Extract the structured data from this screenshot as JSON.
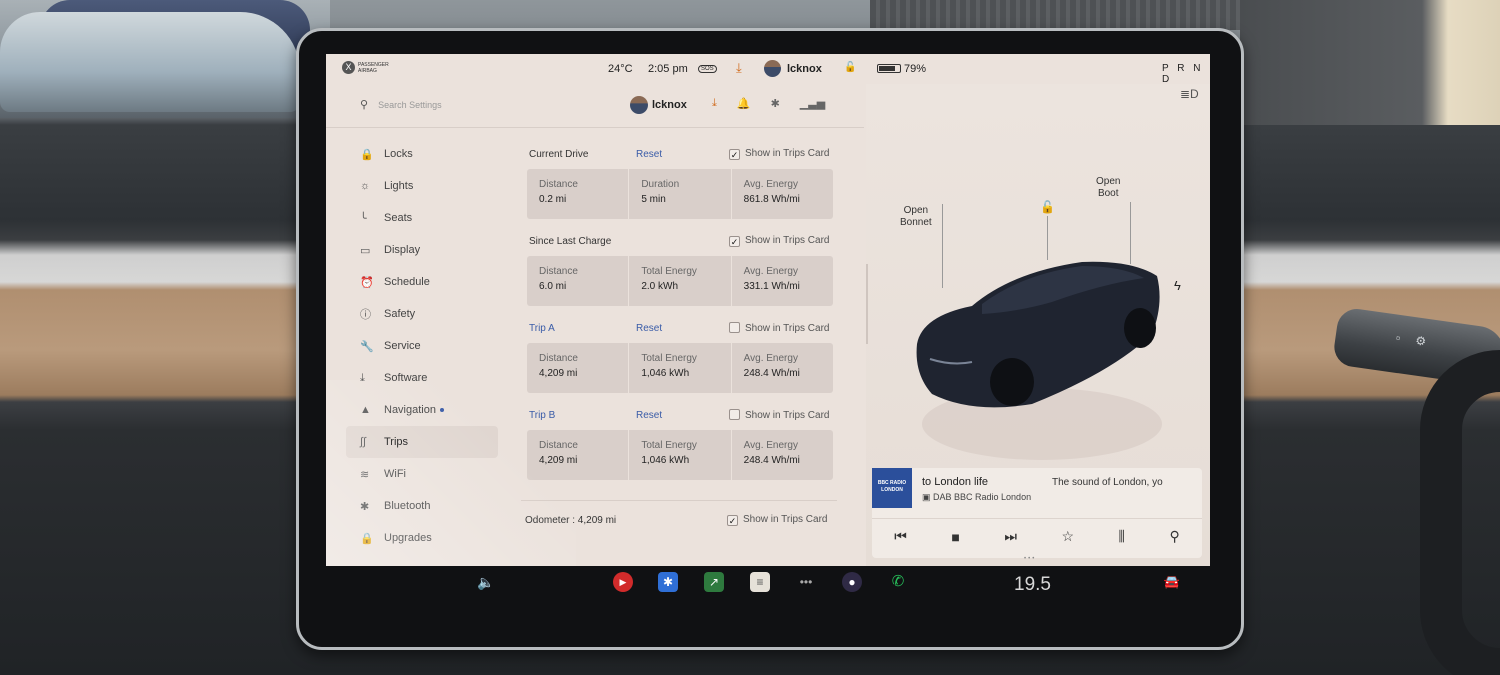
{
  "status_bar": {
    "airbag_line1": "PASSENGER",
    "airbag_line2": "AIRBAG",
    "airbag_icon": "X",
    "temperature": "24°C",
    "time": "2:05 pm",
    "sos": "SOS",
    "user": "lcknox",
    "battery_percent": "79%",
    "battery_level": 0.79,
    "gear": "P R N D"
  },
  "settings_header": {
    "search_placeholder": "Search Settings",
    "user": "lcknox"
  },
  "sidebar": {
    "items": [
      {
        "label": "Locks",
        "icon": "🔒"
      },
      {
        "label": "Lights",
        "icon": "☼"
      },
      {
        "label": "Seats",
        "icon": "╰"
      },
      {
        "label": "Display",
        "icon": "▭"
      },
      {
        "label": "Schedule",
        "icon": "⏰"
      },
      {
        "label": "Safety",
        "icon": "ⓘ"
      },
      {
        "label": "Service",
        "icon": "🔧"
      },
      {
        "label": "Software",
        "icon": "⤓"
      },
      {
        "label": "Navigation",
        "icon": "▲"
      },
      {
        "label": "Trips",
        "icon": "∫∫"
      },
      {
        "label": "WiFi",
        "icon": "≋"
      },
      {
        "label": "Bluetooth",
        "icon": "✱"
      },
      {
        "label": "Upgrades",
        "icon": "🔒"
      }
    ]
  },
  "trips": {
    "show_label": "Show in Trips Card",
    "current_drive": {
      "title": "Current Drive",
      "reset": "Reset",
      "checked": true,
      "stats": [
        {
          "label": "Distance",
          "value": "0.2 mi"
        },
        {
          "label": "Duration",
          "value": "5 min"
        },
        {
          "label": "Avg. Energy",
          "value": "861.8 Wh/mi"
        }
      ]
    },
    "since_last_charge": {
      "title": "Since Last Charge",
      "checked": true,
      "stats": [
        {
          "label": "Distance",
          "value": "6.0 mi"
        },
        {
          "label": "Total Energy",
          "value": "2.0 kWh"
        },
        {
          "label": "Avg. Energy",
          "value": "331.1 Wh/mi"
        }
      ]
    },
    "trip_a": {
      "title": "Trip A",
      "reset": "Reset",
      "checked": false,
      "stats": [
        {
          "label": "Distance",
          "value": "4,209 mi"
        },
        {
          "label": "Total Energy",
          "value": "1,046 kWh"
        },
        {
          "label": "Avg. Energy",
          "value": "248.4 Wh/mi"
        }
      ]
    },
    "trip_b": {
      "title": "Trip B",
      "reset": "Reset",
      "checked": false,
      "stats": [
        {
          "label": "Distance",
          "value": "4,209 mi"
        },
        {
          "label": "Total Energy",
          "value": "1,046 kWh"
        },
        {
          "label": "Avg. Energy",
          "value": "248.4 Wh/mi"
        }
      ]
    },
    "odometer": {
      "text": "Odometer : 4,209 mi",
      "checked": true
    }
  },
  "car_panel": {
    "open_bonnet_1": "Open",
    "open_bonnet_2": "Bonnet",
    "open_boot_1": "Open",
    "open_boot_2": "Boot"
  },
  "media": {
    "art_line1": "BBC RADIO",
    "art_line2": "LONDON",
    "title": "to London life",
    "subtitle": "The sound of London, yo",
    "station": "DAB BBC Radio London"
  },
  "taskbar": {
    "cabin_temp": "19.5"
  }
}
